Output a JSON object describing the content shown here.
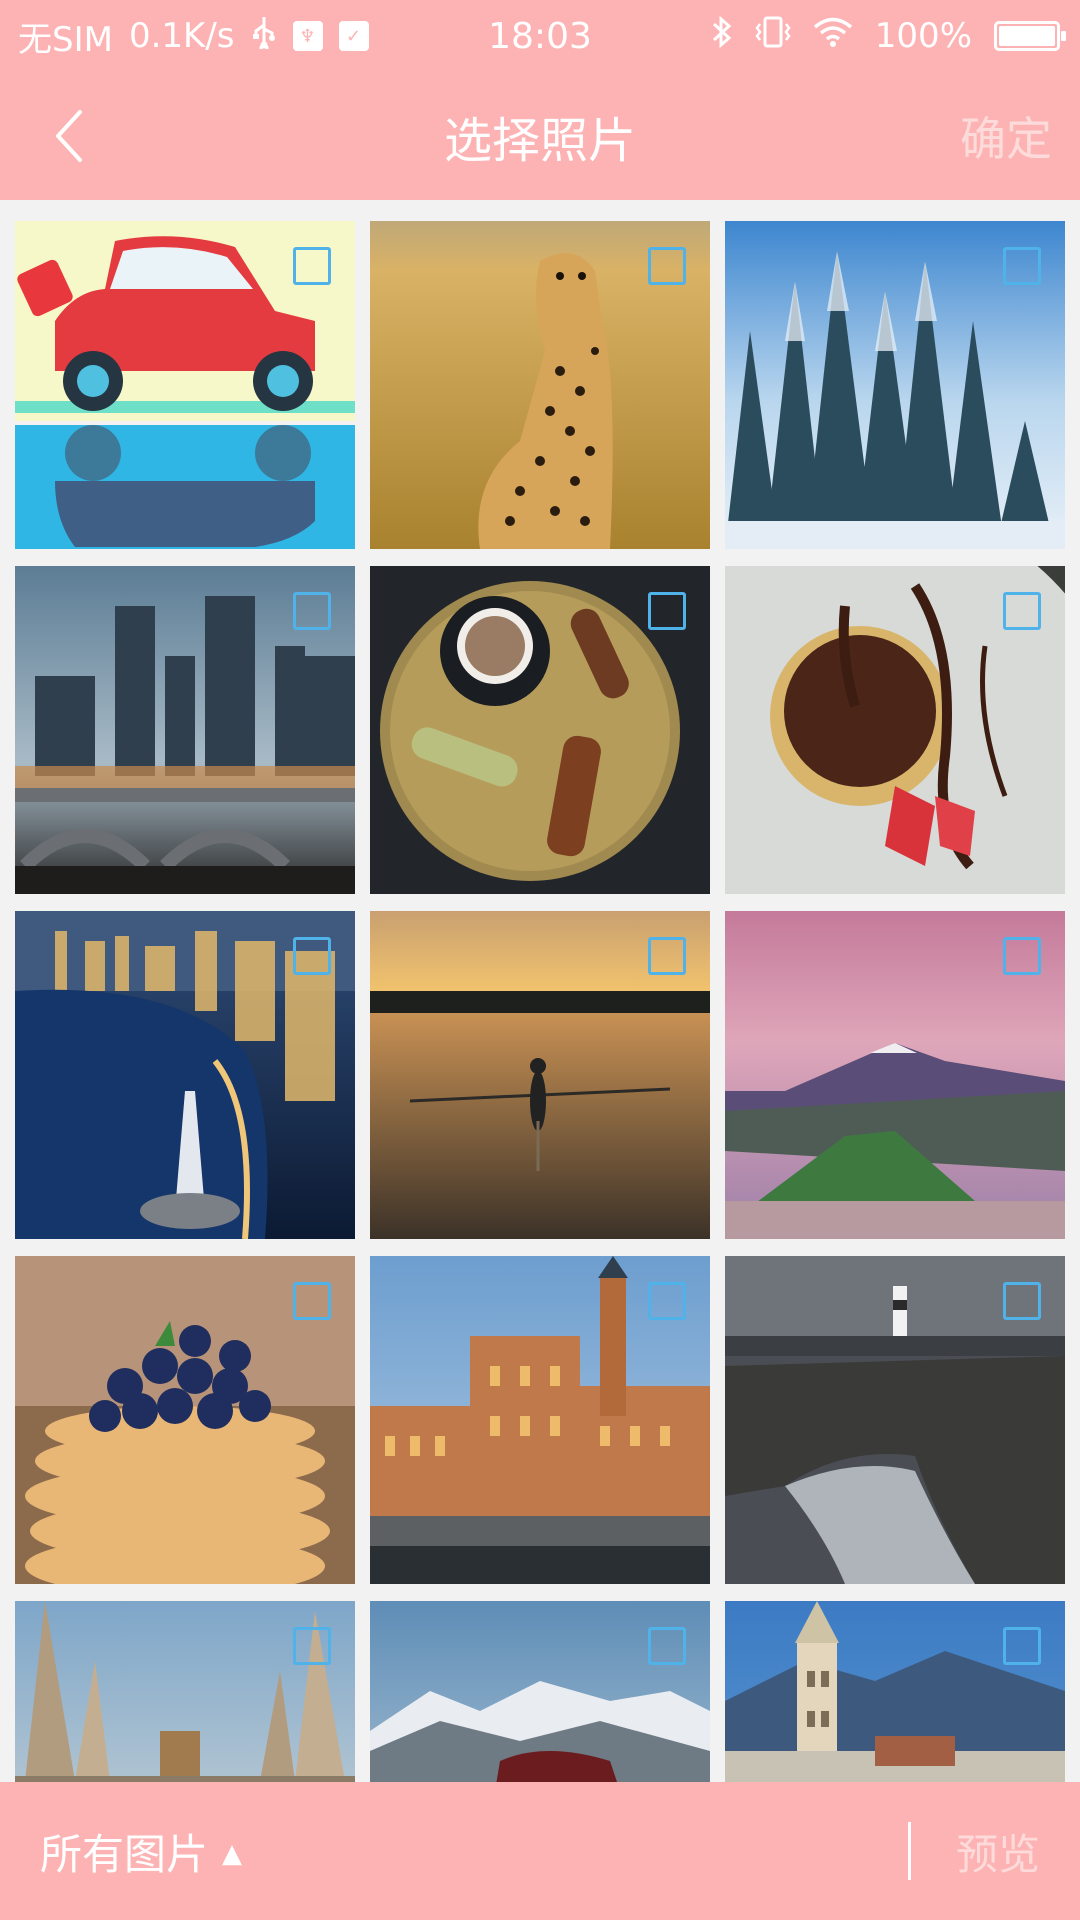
{
  "status_bar": {
    "carrier": "无SIM",
    "speed": "0.1K/s",
    "usb_icon": "usb-icon",
    "usb_debug_icon": "usb-debug-icon",
    "check_icon": "check-icon",
    "time": "18:03",
    "bluetooth_icon": "bluetooth-icon",
    "vibrate_icon": "vibrate-icon",
    "wifi_icon": "wifi-icon",
    "battery": "100%"
  },
  "header": {
    "title": "选择照片",
    "confirm_label": "确定",
    "back_icon": "chevron-left-icon"
  },
  "photos": [
    {
      "subject": "car"
    },
    {
      "subject": "cheetah"
    },
    {
      "subject": "snowy-forest"
    },
    {
      "subject": "city-bridge"
    },
    {
      "subject": "coffee-tray"
    },
    {
      "subject": "chocolate-tart"
    },
    {
      "subject": "night-riverside"
    },
    {
      "subject": "rowing-sunset"
    },
    {
      "subject": "volcano"
    },
    {
      "subject": "blueberry-pancakes"
    },
    {
      "subject": "old-town"
    },
    {
      "subject": "lighthouse-coast"
    },
    {
      "subject": "monument"
    },
    {
      "subject": "mountain-car"
    },
    {
      "subject": "bell-tower"
    }
  ],
  "footer": {
    "album_label": "所有图片",
    "album_caret": "▲",
    "preview_label": "预览"
  },
  "colors": {
    "accent": "#fdb3b3",
    "checkbox_border": "#4fb3ea",
    "background": "#f2f2f2"
  }
}
